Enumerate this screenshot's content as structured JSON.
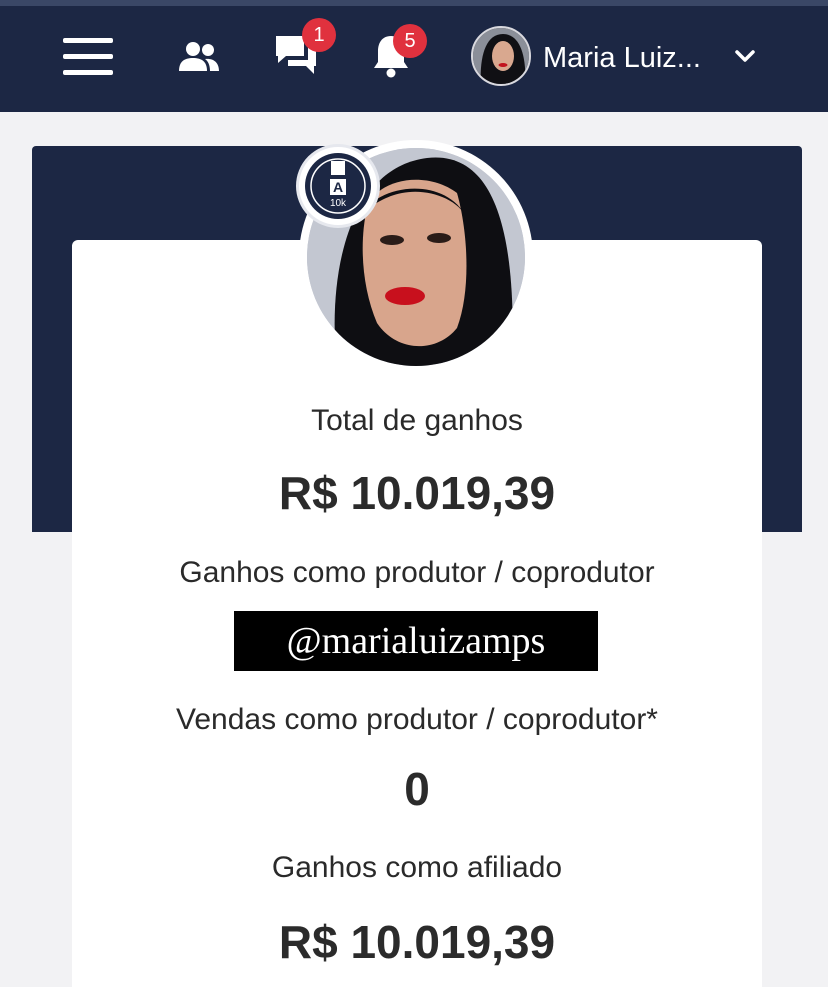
{
  "header": {
    "menu_icon": "hamburger-menu-icon",
    "friends_icon": "users-icon",
    "chat_icon": "chat-bubbles-icon",
    "chat_badge": "1",
    "bell_icon": "bell-icon",
    "bell_badge": "5",
    "user_name": "Maria Luiz...",
    "dropdown_icon": "chevron-down-icon"
  },
  "profile": {
    "level_badge_text": "10k",
    "level_badge_letter": "A"
  },
  "stats": {
    "total_label": "Total de ganhos",
    "total_value": "R$ 10.019,39",
    "producer_earnings_label": "Ganhos como produtor / coprodutor",
    "producer_sales_label": "Vendas como produtor / coprodutor*",
    "producer_sales_value": "0",
    "affiliate_label": "Ganhos como afiliado",
    "affiliate_value": "R$ 10.019,39"
  },
  "overlay": {
    "handle": "@marialuizamps"
  },
  "colors": {
    "navbar": "#1c2744",
    "badge": "#e0313e",
    "card": "#ffffff",
    "page_bg": "#f2f2f4"
  }
}
